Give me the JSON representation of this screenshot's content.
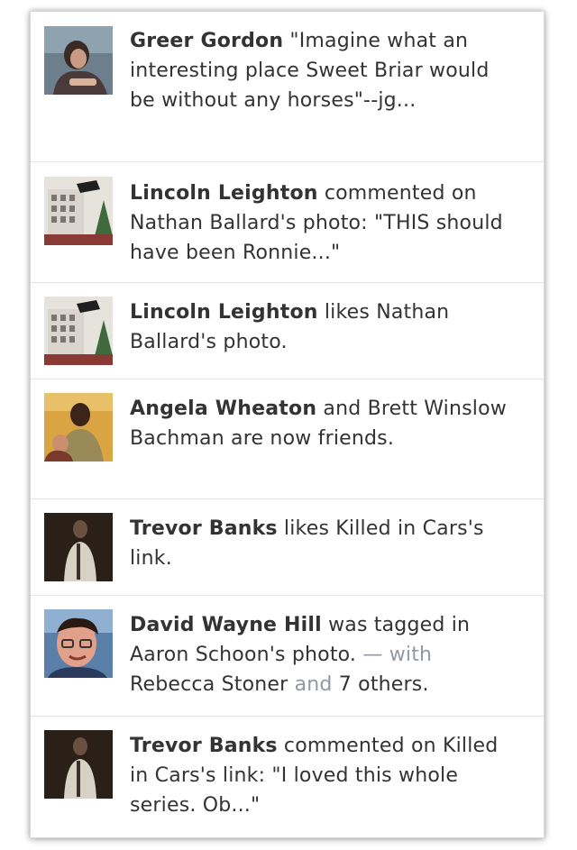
{
  "feed": {
    "items": [
      {
        "avatar": "person-portrait-photo",
        "actor": "Greer Gordon",
        "text": " \"Imagine what an interesting place Sweet Briar would be without any horses\"--jg..."
      },
      {
        "avatar": "building-photo",
        "actor": "Lincoln Leighton",
        "text": " commented on Nathan Ballard's photo: \"THIS should have been Ronnie...\""
      },
      {
        "avatar": "building-photo",
        "actor": "Lincoln Leighton",
        "text": " likes Nathan Ballard's photo."
      },
      {
        "avatar": "couple-photo",
        "actor": "Angela Wheaton",
        "text": " and Brett Winslow Bachman are now friends."
      },
      {
        "avatar": "person-dark-photo",
        "actor": "Trevor Banks",
        "text": " likes Killed in Cars's link."
      },
      {
        "avatar": "man-glasses-photo",
        "actor": "David Wayne Hill",
        "text": " was tagged in Aaron Schoon's photo.",
        "with_label": " — with ",
        "with_person": "Rebecca Stoner",
        "and_label": " and ",
        "others": "7 others",
        "end": "."
      },
      {
        "avatar": "person-dark-photo",
        "actor": "Trevor Banks",
        "text": " commented on Killed in Cars's link: \"I loved this whole series. Ob...\""
      }
    ]
  },
  "colors": {
    "text": "#333333",
    "muted": "#9197a3",
    "divider": "#e3e3e3"
  }
}
